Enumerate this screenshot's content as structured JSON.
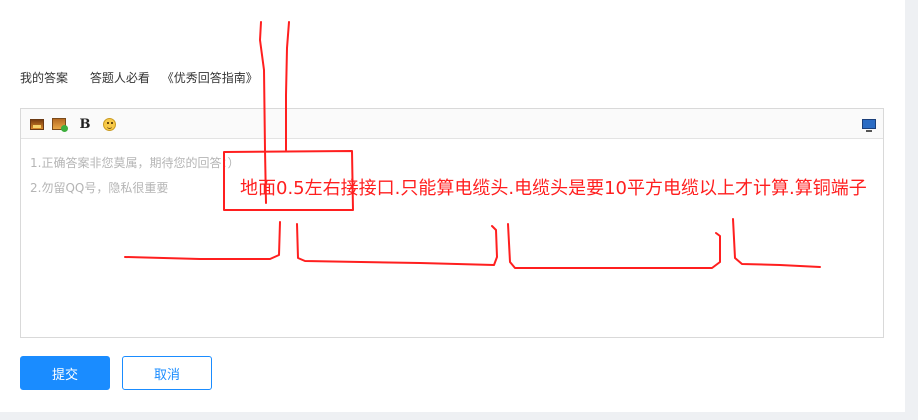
{
  "nav": {
    "my_answer": "我的答案",
    "must_read": "答题人必看",
    "guide_link": "《优秀回答指南》"
  },
  "toolbar": {
    "image_icon": "image-icon",
    "album_icon": "album-icon",
    "bold_label": "B",
    "emoji_icon": "emoji-icon",
    "preview_icon": "preview-icon"
  },
  "editor": {
    "placeholder_line1": "1.正确答案非您莫属，期待您的回答：）",
    "placeholder_line2": "2.勿留QQ号，隐私很重要"
  },
  "annotation": {
    "text": "地面0.5左右接接口.只能算电缆头.电缆头是要10平方电缆以上才计算.算铜端子",
    "color": "#ff1f1f"
  },
  "buttons": {
    "submit": "提交",
    "cancel": "取消"
  },
  "colors": {
    "accent": "#1a8cff",
    "placeholder": "#b5b5b5",
    "annotation": "#ff1f1f"
  }
}
